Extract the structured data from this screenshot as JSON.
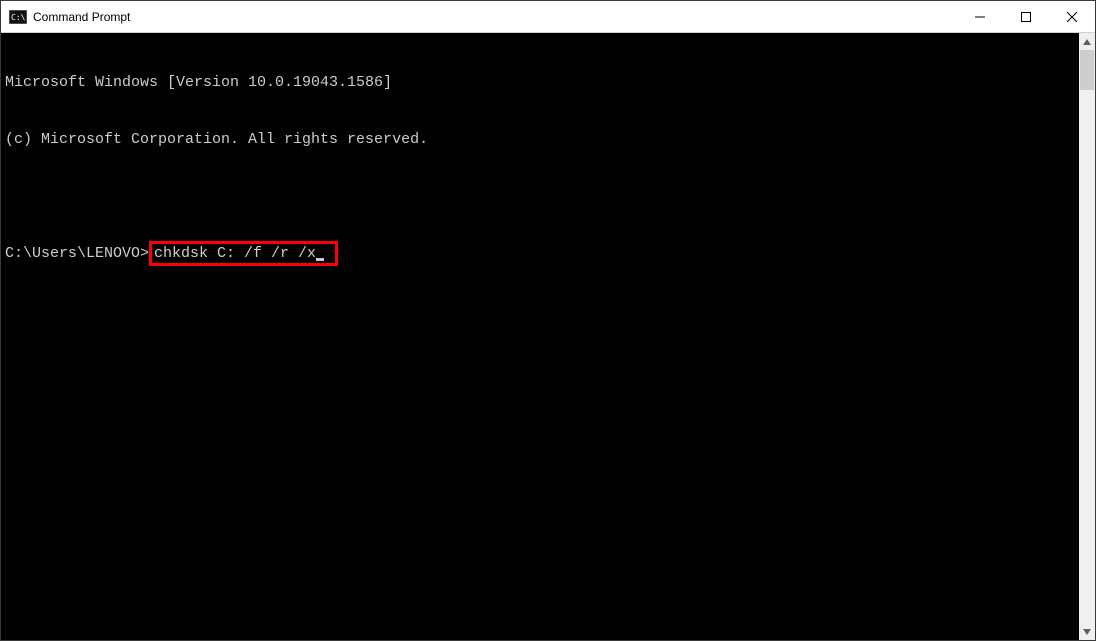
{
  "window": {
    "title": "Command Prompt"
  },
  "terminal": {
    "line1": "Microsoft Windows [Version 10.0.19043.1586]",
    "line2": "(c) Microsoft Corporation. All rights reserved.",
    "prompt": "C:\\Users\\LENOVO>",
    "command": "chkdsk C: /f /r /x"
  },
  "highlight": {
    "color": "#ff0000"
  }
}
